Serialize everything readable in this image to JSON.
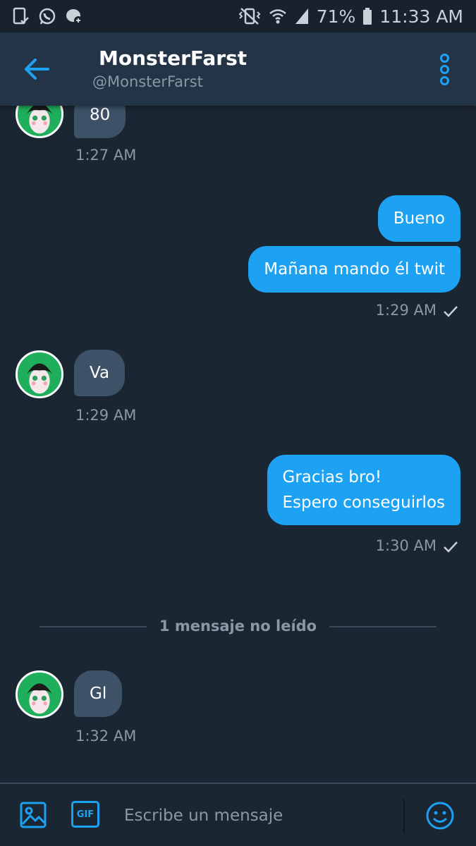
{
  "status_bar": {
    "battery_percent": "71%",
    "time": "11:33 AM"
  },
  "header": {
    "name": "MonsterFarst",
    "handle": "@MonsterFarst"
  },
  "messages": [
    {
      "direction": "in",
      "lines": [
        "80"
      ],
      "time": "1:27 AM"
    },
    {
      "direction": "out",
      "lines": [
        "Bueno"
      ]
    },
    {
      "direction": "out",
      "lines": [
        "Mañana mando él twit"
      ],
      "time": "1:29 AM"
    },
    {
      "direction": "in",
      "lines": [
        "Va"
      ],
      "time": "1:29 AM"
    },
    {
      "direction": "out",
      "lines": [
        "Gracias bro!",
        "Espero conseguirlos"
      ],
      "time": "1:30 AM"
    },
    {
      "direction": "in",
      "lines": [
        "Gl"
      ],
      "time": "1:32 AM"
    }
  ],
  "unread_divider": "1 mensaje no leído",
  "composer": {
    "gif_label": "GIF",
    "placeholder": "Escribe un mensaje"
  },
  "colors": {
    "background": "#1b2633",
    "header": "#243447",
    "accent": "#1da1f2",
    "incoming_bubble": "#3d5266",
    "muted_text": "#8899a6"
  }
}
